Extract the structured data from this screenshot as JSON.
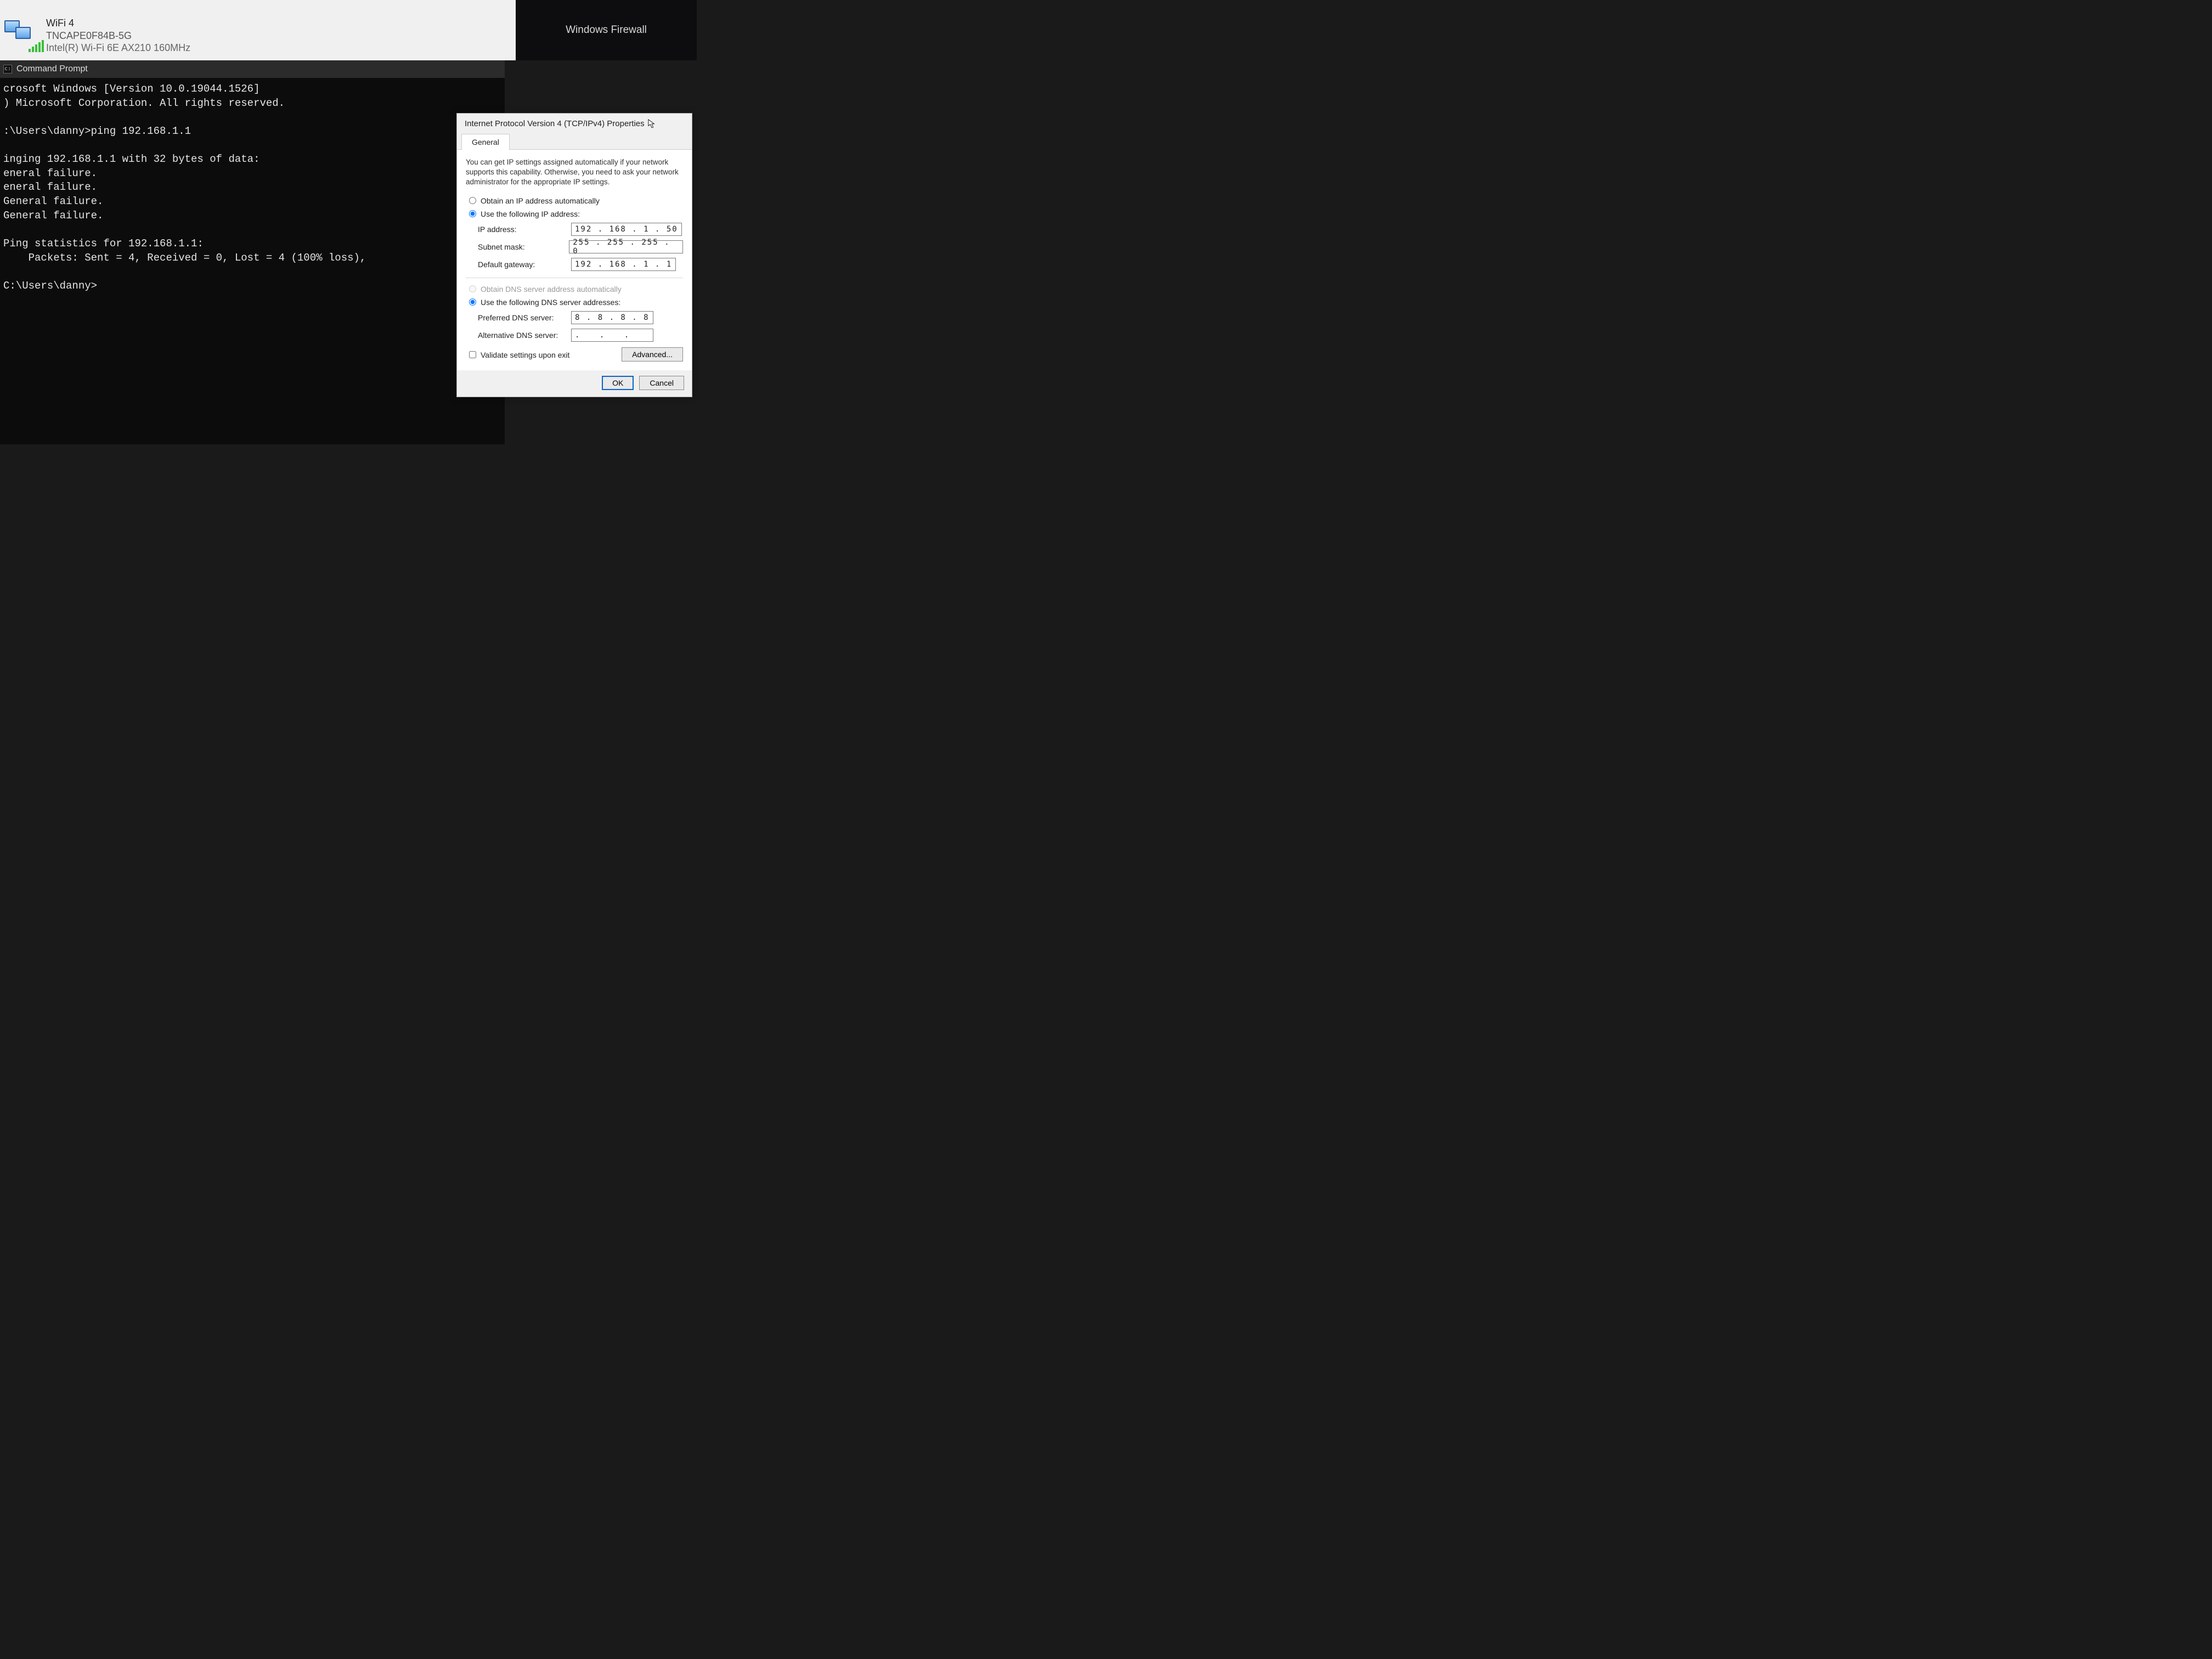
{
  "network_bar": {
    "name": "WiFi 4",
    "ssid": "TNCAPE0F84B-5G",
    "adapter": "Intel(R) Wi-Fi 6E AX210 160MHz"
  },
  "dark_strip": {
    "label": "Windows Firewall"
  },
  "cmd": {
    "title": "Command Prompt",
    "lines": [
      "crosoft Windows [Version 10.0.19044.1526]",
      ") Microsoft Corporation. All rights reserved.",
      "",
      ":\\Users\\danny>ping 192.168.1.1",
      "",
      "inging 192.168.1.1 with 32 bytes of data:",
      "eneral failure.",
      "eneral failure.",
      "General failure.",
      "General failure.",
      "",
      "Ping statistics for 192.168.1.1:",
      "    Packets: Sent = 4, Received = 0, Lost = 4 (100% loss),",
      "",
      "C:\\Users\\danny>"
    ]
  },
  "ipv4": {
    "title": "Internet Protocol Version 4 (TCP/IPv4) Properties",
    "tab_general": "General",
    "description": "You can get IP settings assigned automatically if your network supports this capability. Otherwise, you need to ask your network administrator for the appropriate IP settings.",
    "radio_obtain_ip": "Obtain an IP address automatically",
    "radio_use_ip": "Use the following IP address:",
    "label_ip": "IP address:",
    "label_mask": "Subnet mask:",
    "label_gw": "Default gateway:",
    "value_ip": "192 . 168 .   1  .  50",
    "value_mask": "255 . 255 . 255 .   0",
    "value_gw": "192 . 168 .   1  .   1",
    "radio_obtain_dns": "Obtain DNS server address automatically",
    "radio_use_dns": "Use the following DNS server addresses:",
    "label_dns1": "Preferred DNS server:",
    "label_dns2": "Alternative DNS server:",
    "value_dns1": "  8  .   8  .   8  .   8",
    "value_dns2": ".   .   .",
    "check_validate": "Validate settings upon exit",
    "btn_advanced": "Advanced...",
    "btn_ok": "OK",
    "btn_cancel": "Cancel"
  }
}
